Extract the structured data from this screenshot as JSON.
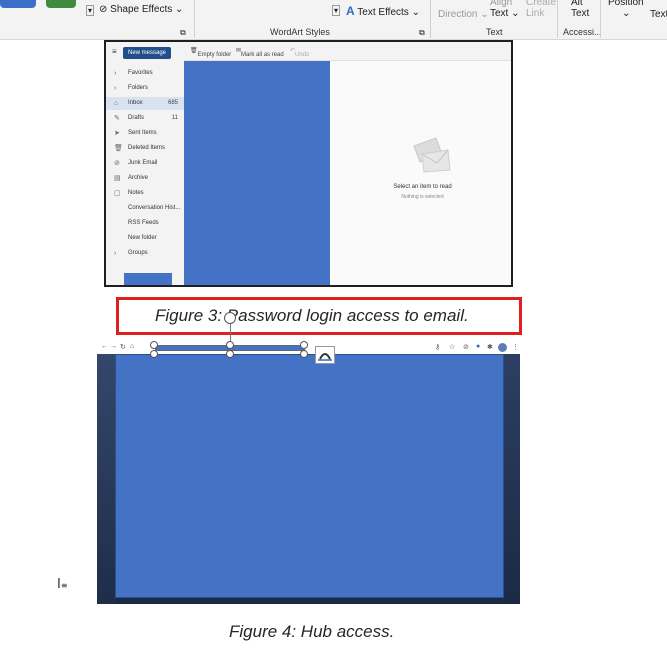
{
  "ribbon": {
    "shape_effects": "Shape Effects",
    "wordart_styles": "WordArt Styles",
    "text_effects": "Text Effects",
    "text_direction": "Direction",
    "align_text": "Text",
    "align_top": "Align",
    "create_link": "Link",
    "create_top": "Create",
    "alt_text": "Text",
    "alt_top": "Alt",
    "text_group": "Text",
    "accessibility_group": "Accessi...",
    "position": "Position",
    "wrap_text": "Text"
  },
  "mail": {
    "new_message": "New message",
    "toolbar": {
      "empty_folder": "Empty folder",
      "mark_all_read": "Mark all as read",
      "undo": "Undo"
    },
    "nav": [
      {
        "icon": "chevron",
        "label": "Favorites",
        "count": ""
      },
      {
        "icon": "chevron",
        "label": "Folders",
        "count": ""
      },
      {
        "icon": "inbox",
        "label": "Inbox",
        "count": "685"
      },
      {
        "icon": "pencil",
        "label": "Drafts",
        "count": "11"
      },
      {
        "icon": "send",
        "label": "Sent Items",
        "count": ""
      },
      {
        "icon": "trash",
        "label": "Deleted Items",
        "count": ""
      },
      {
        "icon": "block",
        "label": "Junk Email",
        "count": ""
      },
      {
        "icon": "archive",
        "label": "Archive",
        "count": ""
      },
      {
        "icon": "note",
        "label": "Notes",
        "count": ""
      },
      {
        "icon": "",
        "label": "Conversation Hist...",
        "count": ""
      },
      {
        "icon": "",
        "label": "RSS Feeds",
        "count": ""
      },
      {
        "icon": "",
        "label": "New folder",
        "count": ""
      },
      {
        "icon": "chevron",
        "label": "Groups",
        "count": ""
      }
    ],
    "reading_title": "Select an item to read",
    "reading_sub": "Nothing is selected"
  },
  "figure3": {
    "caption": "Figure 3: Password login access to email."
  },
  "figure4": {
    "caption": "Figure 4: Hub access."
  },
  "colors": {
    "placeholder_blue": "#4472c4",
    "highlight_red": "#e02020"
  }
}
